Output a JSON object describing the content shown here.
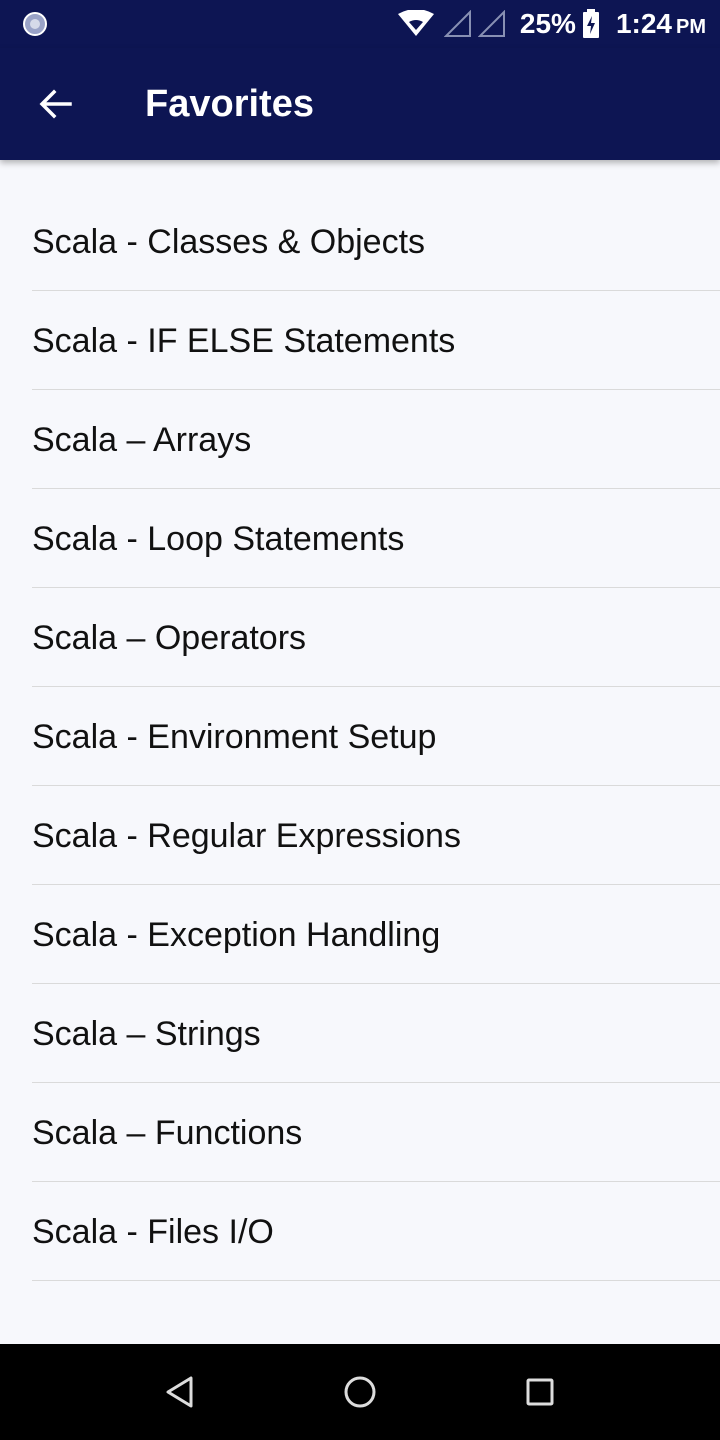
{
  "colors": {
    "app_bar": "#0D1553",
    "background": "#F7F8FC",
    "text": "#111111",
    "divider": "#DADADA",
    "nav_bar": "#000000"
  },
  "status_bar": {
    "battery_text": "25%",
    "time": "1:24",
    "ampm": "PM",
    "icons": [
      "notification-icon",
      "wifi-icon",
      "signal-icon",
      "battery-charging-icon"
    ]
  },
  "app_bar": {
    "title": "Favorites",
    "back_icon": "arrow-back-icon"
  },
  "favorites": [
    {
      "label": "Scala - Classes & Objects"
    },
    {
      "label": "Scala - IF ELSE Statements"
    },
    {
      "label": "Scala – Arrays"
    },
    {
      "label": "Scala - Loop Statements"
    },
    {
      "label": "Scala – Operators"
    },
    {
      "label": "Scala - Environment Setup"
    },
    {
      "label": "Scala - Regular Expressions"
    },
    {
      "label": "Scala - Exception Handling"
    },
    {
      "label": "Scala – Strings"
    },
    {
      "label": "Scala – Functions"
    },
    {
      "label": "Scala - Files I/O"
    }
  ],
  "nav_bar": {
    "icons": [
      "nav-back-icon",
      "nav-home-icon",
      "nav-recents-icon"
    ]
  }
}
